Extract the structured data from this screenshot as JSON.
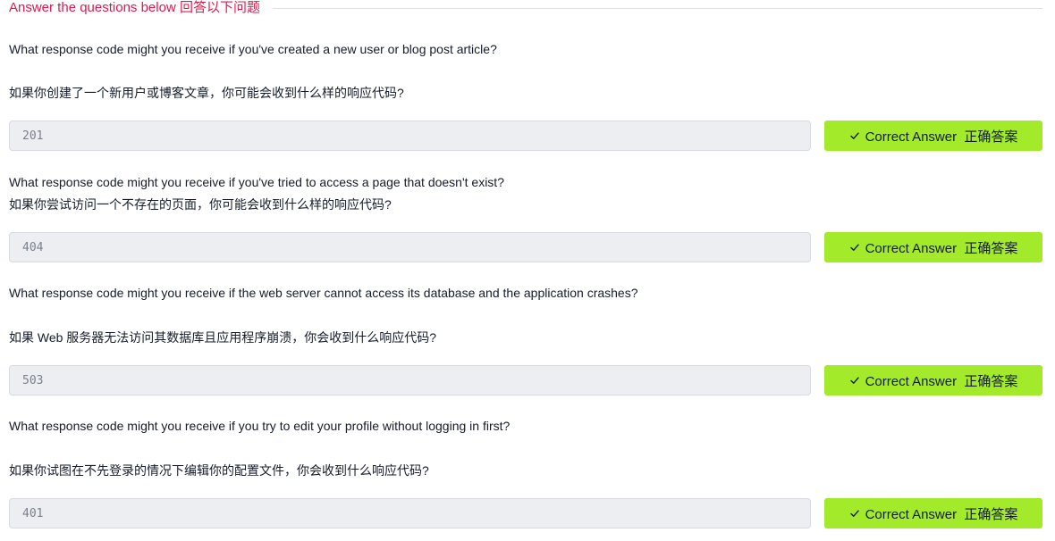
{
  "header": {
    "title": "Answer the questions below 回答以下问题"
  },
  "questions": [
    {
      "text_en": "What response code might you receive if you've created a new user or blog post article?",
      "text_zh": "如果你创建了一个新用户或博客文章，你可能会收到什么样的响应代码?",
      "answer": "201",
      "button_label": "Correct Answer  正确答案"
    },
    {
      "text_en": "What response code might you receive if you've tried to access a page that doesn't exist?",
      "text_zh": "如果你尝试访问一个不存在的页面，你可能会收到什么样的响应代码?",
      "answer": "404",
      "button_label": "Correct Answer  正确答案"
    },
    {
      "text_en": "What response code might you receive if the web server cannot access its database and the application crashes?",
      "text_zh": "如果 Web 服务器无法访问其数据库且应用程序崩溃，你会收到什么响应代码?",
      "answer": "503",
      "button_label": "Correct Answer  正确答案"
    },
    {
      "text_en": "What response code might you receive if you try to edit your profile without logging in first?",
      "text_zh": "如果你试图在不先登录的情况下编辑你的配置文件，你会收到什么响应代码?",
      "answer": "401",
      "button_label": "Correct Answer  正确答案"
    }
  ],
  "colors": {
    "accent_title": "#e6174c",
    "correct_button": "#a3ea2a",
    "field_background": "#eceef2"
  },
  "icons": {
    "button_icon": "check-icon"
  }
}
